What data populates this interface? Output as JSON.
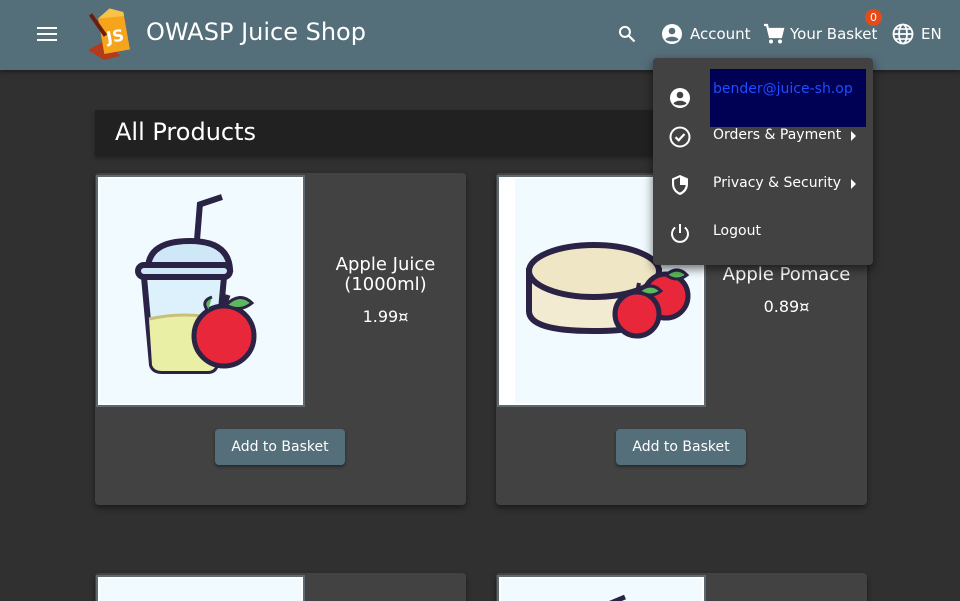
{
  "app": {
    "title": "OWASP Juice Shop"
  },
  "toolbar": {
    "account_label": "Account",
    "basket_label": "Your Basket",
    "basket_count": "0",
    "language_label": "EN"
  },
  "section": {
    "title": "All Products"
  },
  "products": [
    {
      "name": "Apple Juice (1000ml)",
      "price": "1.99¤",
      "button": "Add to Basket"
    },
    {
      "name": "Apple Pomace",
      "price": "0.89¤",
      "button": "Add to Basket"
    }
  ],
  "account_menu": {
    "email": "bender@juice-sh.op",
    "items": [
      {
        "label": "Orders & Payment"
      },
      {
        "label": "Privacy & Security"
      },
      {
        "label": "Logout"
      }
    ]
  },
  "icons": {
    "menu": "menu-icon",
    "search": "search-icon",
    "account": "account-circle-icon",
    "basket": "shopping-cart-icon",
    "language": "globe-icon"
  },
  "colors": {
    "toolbar": "#546e7a",
    "background": "#303030",
    "card": "#424242",
    "badge": "#e64a19"
  }
}
